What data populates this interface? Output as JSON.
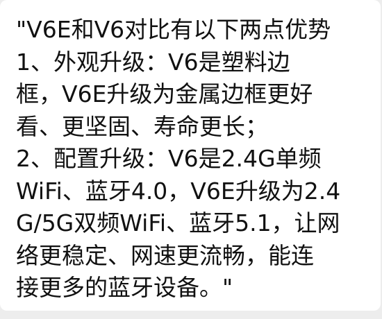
{
  "message": {
    "lines": [
      "\"V6E和V6对比有以下两点优势",
      "1、外观升级：V6是塑料边",
      "框，V6E升级为金属边框更好",
      "看、更坚固、寿命更长；",
      "2、配置升级：V6是2.4G单频",
      "WiFi、蓝牙4.0，V6E升级为2.4",
      "G/5G双频WiFi、蓝牙5.1，让网",
      "络更稳定、网速更流畅，能连",
      "接更多的蓝牙设备。\""
    ]
  }
}
